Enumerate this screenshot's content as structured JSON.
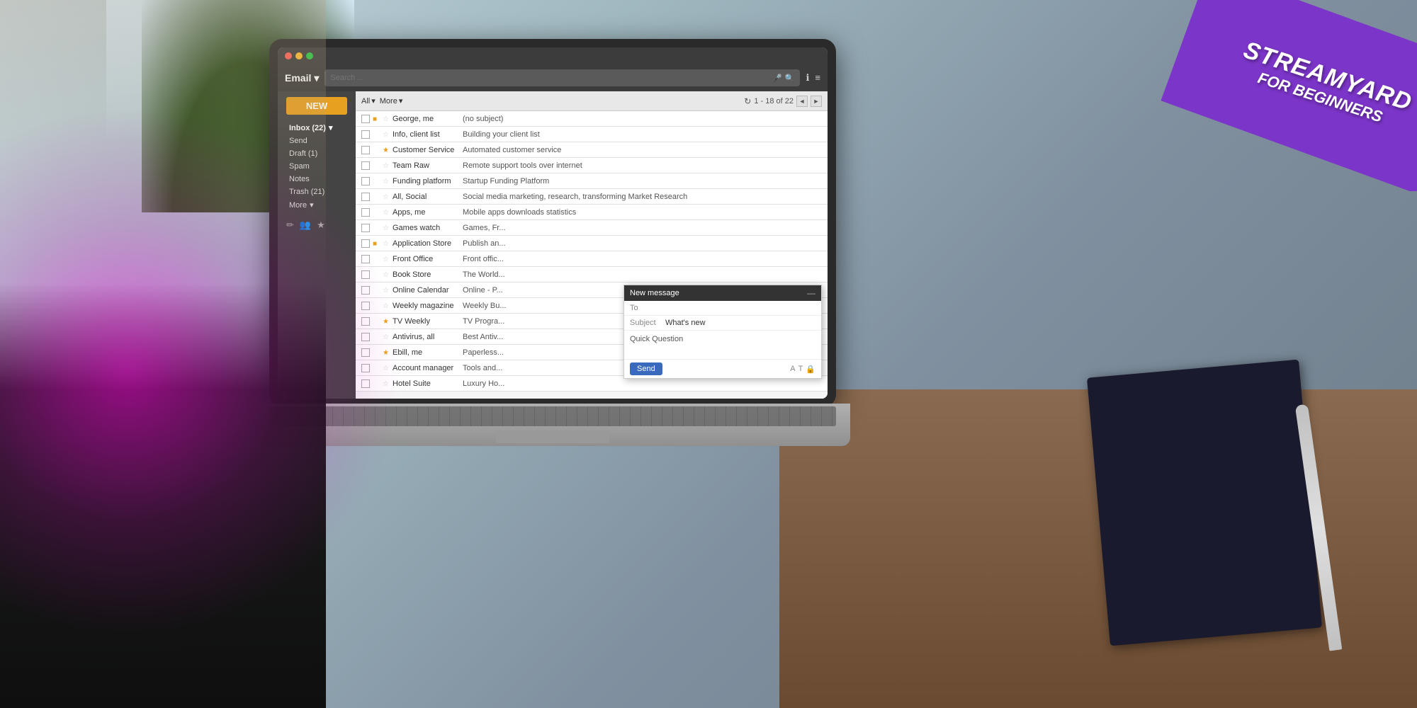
{
  "background": {
    "color": "#6a7a85"
  },
  "banner": {
    "line1": "STREAMYARD",
    "line2": "FOR BEGINNERS",
    "bg_color": "#7b35c8"
  },
  "email_ui": {
    "title": "Email",
    "dropdown_arrow": "▾",
    "search_placeholder": "Search ...",
    "mic_icon": "🎤",
    "search_icon": "🔍",
    "info_icon": "ℹ",
    "menu_icon": "≡",
    "new_button": "NEW",
    "sidebar_items": [
      {
        "label": "Inbox (22)",
        "has_arrow": true,
        "id": "inbox"
      },
      {
        "label": "Send",
        "id": "send"
      },
      {
        "label": "Draft (1)",
        "id": "draft"
      },
      {
        "label": "Spam",
        "id": "spam"
      },
      {
        "label": "Notes",
        "id": "notes"
      },
      {
        "label": "Trash (21)",
        "id": "trash"
      },
      {
        "label": "More",
        "id": "more",
        "has_arrow": true
      }
    ],
    "toolbar": {
      "all_label": "All",
      "more_label": "More",
      "dropdown_arrow": "▾",
      "refresh_icon": "↻",
      "pagination": "1 - 18 of 22",
      "prev_icon": "◄",
      "next_icon": "►"
    },
    "emails": [
      {
        "sender": "George, me",
        "subject": "(no subject)",
        "starred": false,
        "tag": "yellow",
        "unread": false
      },
      {
        "sender": "Info, client list",
        "subject": "Building your client list",
        "starred": false,
        "tag": "none",
        "unread": false
      },
      {
        "sender": "Customer Service",
        "subject": "Automated customer service",
        "starred": true,
        "tag": "none",
        "unread": false
      },
      {
        "sender": "Team Raw",
        "subject": "Remote support tools over internet",
        "starred": false,
        "tag": "none",
        "unread": false
      },
      {
        "sender": "Funding platform",
        "subject": "Startup Funding Platform",
        "starred": false,
        "tag": "none",
        "unread": false
      },
      {
        "sender": "All, Social",
        "subject": "Social media marketing, research, transforming Market Research",
        "starred": false,
        "tag": "none",
        "unread": false
      },
      {
        "sender": "Apps, me",
        "subject": "Mobile apps downloads statistics",
        "starred": false,
        "tag": "none",
        "unread": false
      },
      {
        "sender": "Games watch",
        "subject": "Games, Fr...",
        "starred": false,
        "tag": "none",
        "unread": false
      },
      {
        "sender": "Application Store",
        "subject": "Publish an...",
        "starred": false,
        "tag": "yellow",
        "unread": false
      },
      {
        "sender": "Front Office",
        "subject": "Front offic...",
        "starred": false,
        "tag": "none",
        "unread": false
      },
      {
        "sender": "Book Store",
        "subject": "The World...",
        "starred": false,
        "tag": "none",
        "unread": false
      },
      {
        "sender": "Online Calendar",
        "subject": "Online - P...",
        "starred": false,
        "tag": "none",
        "unread": false
      },
      {
        "sender": "Weekly magazine",
        "subject": "Weekly Bu...",
        "starred": false,
        "tag": "none",
        "unread": false
      },
      {
        "sender": "TV Weekly",
        "subject": "TV Progra...",
        "starred": true,
        "tag": "none",
        "unread": false
      },
      {
        "sender": "Antivirus, all",
        "subject": "Best Antiv...",
        "starred": false,
        "tag": "none",
        "unread": false
      },
      {
        "sender": "Ebill, me",
        "subject": "Paperless...",
        "starred": true,
        "tag": "none",
        "unread": false
      },
      {
        "sender": "Account manager",
        "subject": "Tools and...",
        "starred": false,
        "tag": "none",
        "unread": false
      },
      {
        "sender": "Hotel Suite",
        "subject": "Luxury Ho...",
        "starred": false,
        "tag": "none",
        "unread": false
      }
    ],
    "new_message": {
      "title": "New message",
      "close_icon": "—",
      "to_label": "To",
      "subject_label": "Subject",
      "subject_value": "What's new",
      "body_text": "Quick Question",
      "send_label": "Send",
      "footer_icons": [
        "A",
        "T",
        "🔒"
      ]
    }
  }
}
